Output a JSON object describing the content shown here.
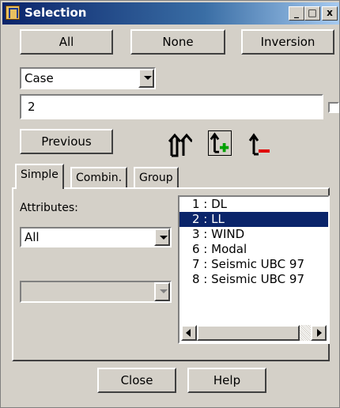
{
  "window": {
    "title": "Selection"
  },
  "titlebar": {
    "minimize": "_",
    "maximize": "□",
    "close": "x"
  },
  "top_buttons": {
    "all": "All",
    "none": "None",
    "inversion": "Inversion"
  },
  "type_combo": {
    "selected": "Case"
  },
  "text_field": {
    "value": "2"
  },
  "previous_button": "Previous",
  "tabs": [
    "Simple",
    "Combin.",
    "Group"
  ],
  "simple": {
    "attributes_label": "Attributes:",
    "attributes_selected": "All",
    "second_combo": ""
  },
  "case_list": {
    "items": [
      "1 : DL",
      "2 : LL",
      "3 : WIND",
      "6 : Modal",
      "7 : Seismic UBC 97",
      "8 : Seismic UBC 97"
    ],
    "selected_index": 1
  },
  "bottom_buttons": {
    "close": "Close",
    "help": "Help"
  },
  "icons": {
    "select_all": "up-arrows-icon",
    "add": "add-arrow-icon",
    "remove": "remove-arrow-icon"
  },
  "colors": {
    "titlebar": "#0a246a",
    "selection": "#0a246a",
    "add_accent": "#00a000",
    "remove_accent": "#e00000"
  }
}
